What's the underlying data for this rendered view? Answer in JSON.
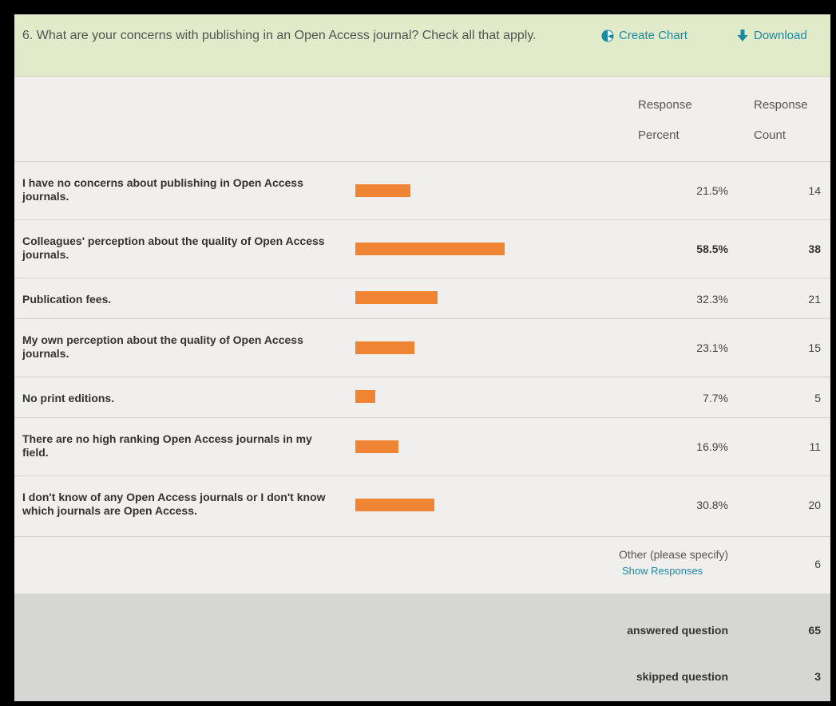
{
  "question": {
    "title": "6. What are your concerns with publishing in an Open Access journal? Check all that apply."
  },
  "tools": {
    "create_chart": "Create Chart",
    "download": "Download"
  },
  "columns": {
    "percent_line1": "Response",
    "percent_line2": "Percent",
    "count_line1": "Response",
    "count_line2": "Count"
  },
  "rows": [
    {
      "label": "I have no concerns about publishing in Open Access journals.",
      "percent": "21.5%",
      "percent_value": 21.5,
      "count": "14"
    },
    {
      "label": "Colleagues' perception about the quality of Open Access journals.",
      "percent": "58.5%",
      "percent_value": 58.5,
      "count": "38"
    },
    {
      "label": "Publication fees.",
      "percent": "32.3%",
      "percent_value": 32.3,
      "count": "21"
    },
    {
      "label": "My own perception about the quality of Open Access journals.",
      "percent": "23.1%",
      "percent_value": 23.1,
      "count": "15"
    },
    {
      "label": "No print editions.",
      "percent": "7.7%",
      "percent_value": 7.7,
      "count": "5"
    },
    {
      "label": "There are no high ranking Open Access journals in my field.",
      "percent": "16.9%",
      "percent_value": 16.9,
      "count": "11"
    },
    {
      "label": "I don't know of any Open Access journals or I don't know which journals are Open Access.",
      "percent": "30.8%",
      "percent_value": 30.8,
      "count": "20"
    }
  ],
  "other": {
    "label": "Other (please specify)",
    "link": "Show Responses",
    "count": "6"
  },
  "summary": {
    "answered_label": "answered question",
    "answered_value": "65",
    "skipped_label": "skipped question",
    "skipped_value": "3"
  },
  "colors": {
    "bar": "#ef8532",
    "header_bg": "#e1ebca",
    "link": "#1a8ba0"
  },
  "icons": {
    "create_chart": "pie-chart-icon",
    "download": "download-arrow-icon"
  }
}
